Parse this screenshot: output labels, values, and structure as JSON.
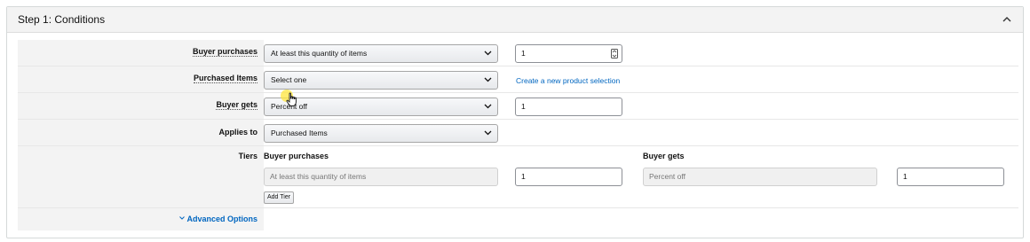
{
  "header": {
    "title": "Step 1: Conditions",
    "collapse_icon": "chevron-up-icon"
  },
  "rows": {
    "buyer_purchases": {
      "label": "Buyer purchases",
      "select_value": "At least this quantity of items",
      "quantity_value": "1"
    },
    "purchased_items": {
      "label": "Purchased Items",
      "select_value": "Select one",
      "link": "Create a new product selection"
    },
    "buyer_gets": {
      "label": "Buyer gets",
      "select_value": "Percent off",
      "amount_value": "1"
    },
    "applies_to": {
      "label": "Applies to",
      "select_value": "Purchased Items"
    },
    "tiers": {
      "label": "Tiers",
      "col_buyer_purchases": "Buyer purchases",
      "col_buyer_gets": "Buyer gets",
      "tier_condition": "At least this quantity of items",
      "tier_quantity": "1",
      "tier_benefit": "Percent off",
      "tier_amount": "1",
      "add_tier_label": "Add Tier"
    },
    "advanced": {
      "label": "Advanced Options",
      "icon": "chevron-down-icon"
    }
  },
  "colors": {
    "link": "#0066c0",
    "label_background": "#f3f3f3",
    "cursor_highlight": "#ffe63c"
  }
}
